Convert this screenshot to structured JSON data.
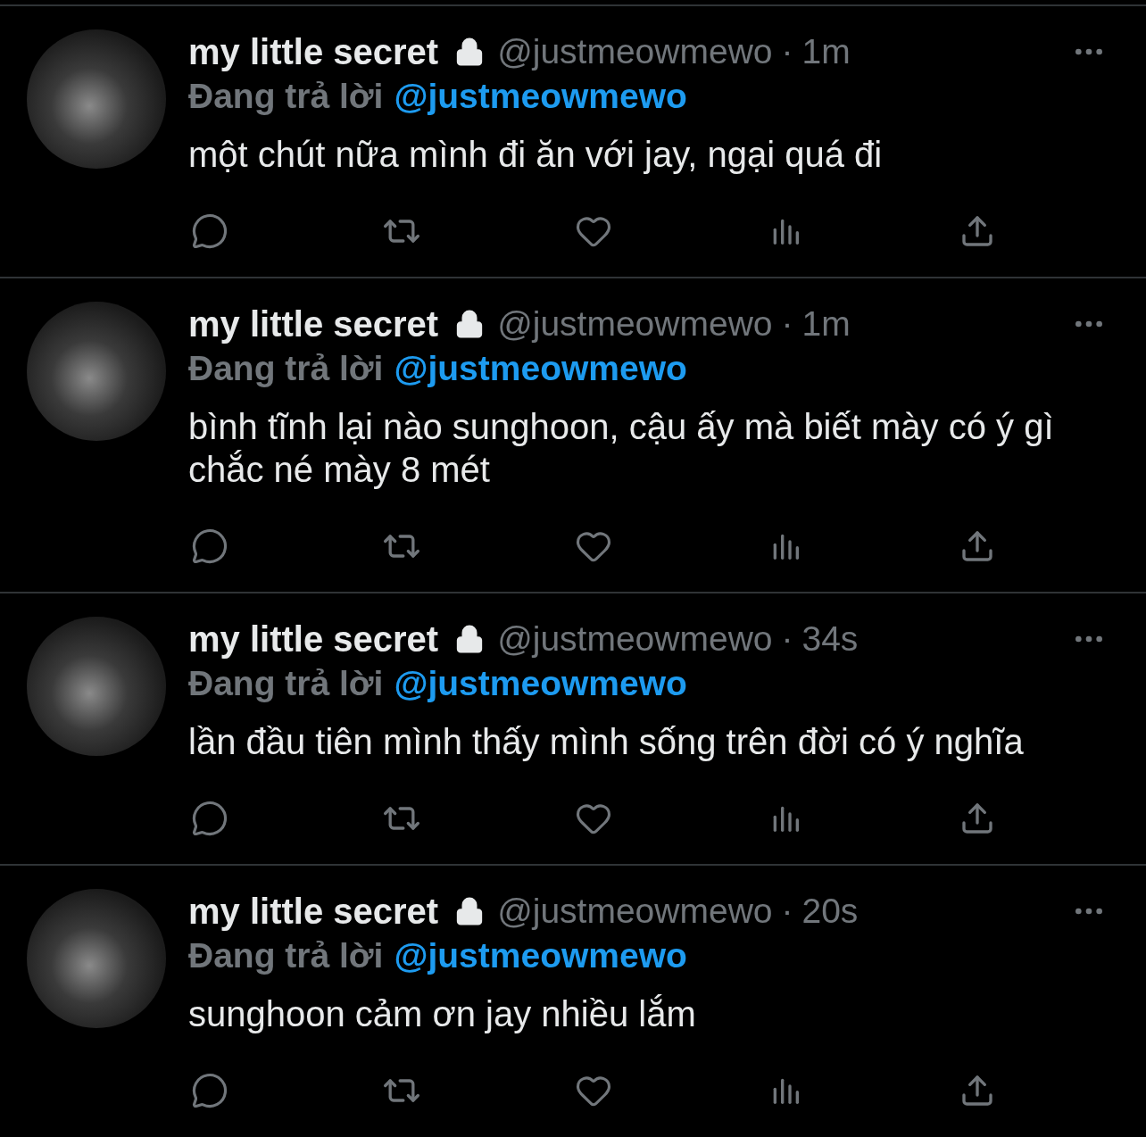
{
  "tweets": [
    {
      "name": "my little secret",
      "locked": true,
      "handle": "@justmeowmewo",
      "separator": "·",
      "time": "1m",
      "reply_label": "Đang trả lời",
      "reply_to": "@justmeowmewo",
      "text": "một chút nữa mình đi ăn với jay, ngại quá đi"
    },
    {
      "name": "my little secret",
      "locked": true,
      "handle": "@justmeowmewo",
      "separator": "·",
      "time": "1m",
      "reply_label": "Đang trả lời",
      "reply_to": "@justmeowmewo",
      "text": "bình tĩnh lại nào sunghoon, cậu ấy mà biết mày có ý gì chắc né mày 8 mét"
    },
    {
      "name": "my little secret",
      "locked": true,
      "handle": "@justmeowmewo",
      "separator": "·",
      "time": "34s",
      "reply_label": "Đang trả lời",
      "reply_to": "@justmeowmewo",
      "text": "lần đầu tiên mình thấy mình sống trên đời có ý nghĩa"
    },
    {
      "name": "my little secret",
      "locked": true,
      "handle": "@justmeowmewo",
      "separator": "·",
      "time": "20s",
      "reply_label": "Đang trả lời",
      "reply_to": "@justmeowmewo",
      "text": "sunghoon cảm ơn jay nhiều lắm"
    }
  ]
}
